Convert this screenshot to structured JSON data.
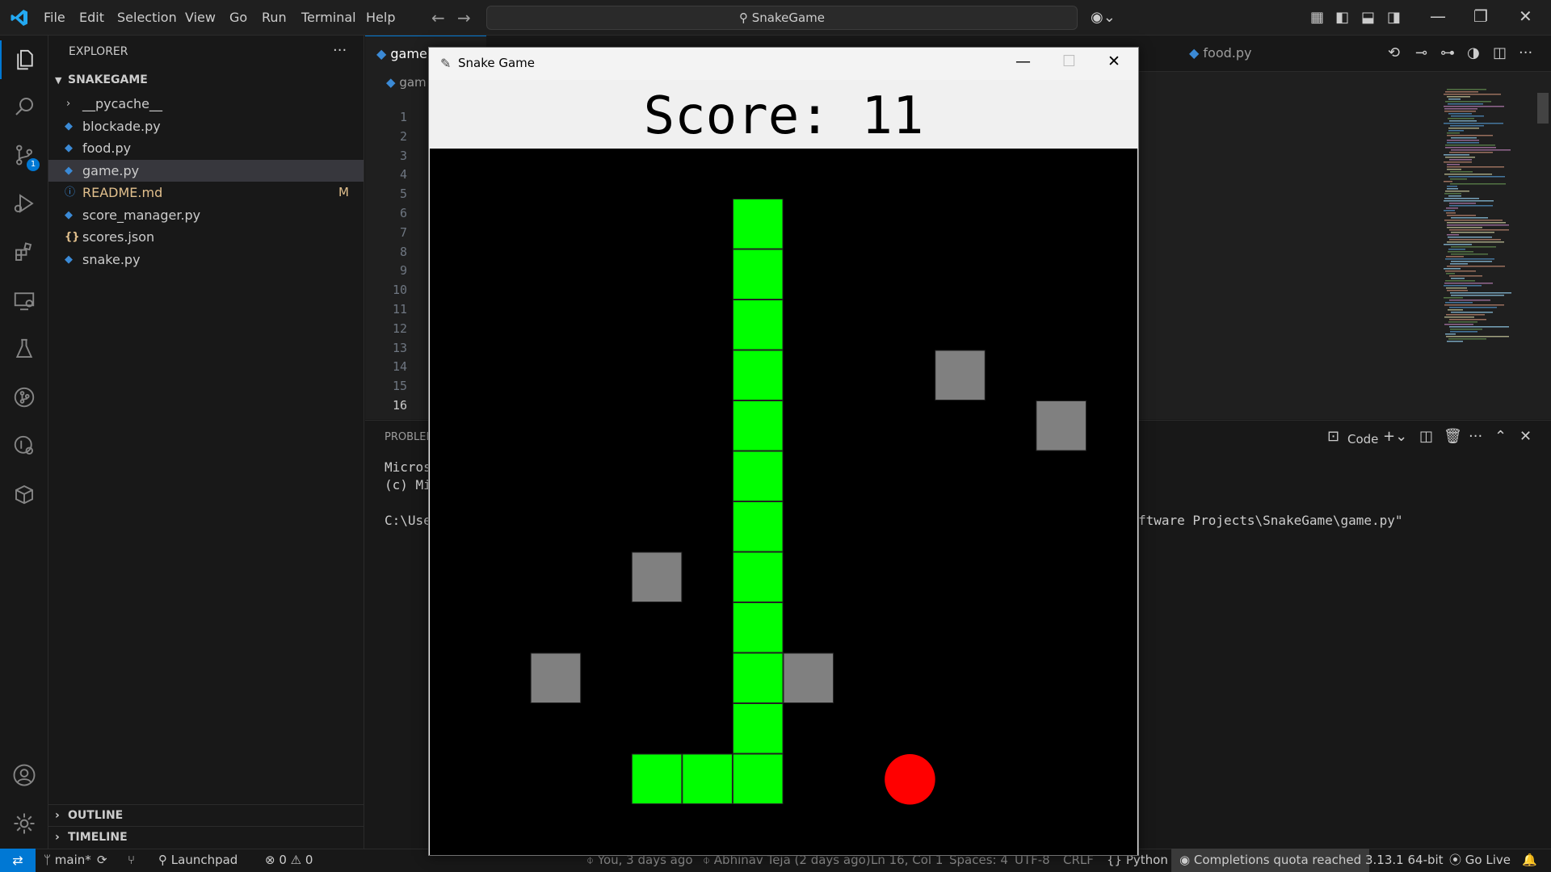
{
  "titlebar": {
    "menus": [
      "File",
      "Edit",
      "Selection",
      "View",
      "Go",
      "Run",
      "Terminal",
      "Help"
    ],
    "search_text": "SnakeGame"
  },
  "activity": {
    "scm_badge": "1"
  },
  "sidebar": {
    "title": "EXPLORER",
    "project": "SNAKEGAME",
    "items": [
      {
        "label": "__pycache__",
        "kind": "folder"
      },
      {
        "label": "blockade.py",
        "kind": "python"
      },
      {
        "label": "food.py",
        "kind": "python"
      },
      {
        "label": "game.py",
        "kind": "python",
        "selected": true
      },
      {
        "label": "README.md",
        "kind": "info",
        "badge": "M"
      },
      {
        "label": "score_manager.py",
        "kind": "python"
      },
      {
        "label": "scores.json",
        "kind": "json"
      },
      {
        "label": "snake.py",
        "kind": "python"
      }
    ],
    "outline": "OUTLINE",
    "timeline": "TIMELINE"
  },
  "editor": {
    "tabs": [
      "game",
      "food.py"
    ],
    "breadcrumb": "gam",
    "line_numbers": [
      "1",
      "2",
      "3",
      "4",
      "5",
      "6",
      "7",
      "8",
      "9",
      "10",
      "11",
      "12",
      "13",
      "14",
      "15",
      "16"
    ],
    "current_line": "16"
  },
  "panel": {
    "tab": "PROBLEM",
    "terminal_lines": [
      "Micros",
      "(c) Mi",
      "",
      "C:\\Use"
    ],
    "terminal_right": "ftware Projects\\SnakeGame\\game.py\"",
    "terminal_label": "Code"
  },
  "statusbar": {
    "branch": "main*",
    "launchpad": "Launchpad",
    "errors": "0",
    "warnings": "0",
    "blame_you": "You, 3 days ago",
    "blame_author": "Abhinav Teja (2 days ago)",
    "cursor": "Ln 16, Col 1",
    "spaces": "Spaces: 4",
    "encoding": "UTF-8",
    "eol": "CRLF",
    "language": "Python",
    "completions": "Completions quota reached",
    "interpreter": "3.13.1 64-bit",
    "golive": "Go Live"
  },
  "game": {
    "window_title": "Snake Game",
    "score_label": "Score:  11",
    "snake_color": "#00ff00",
    "block_color": "#808080",
    "food_color": "#ff0000",
    "grid": {
      "cols": 14,
      "rows": 14
    },
    "snake": [
      [
        6,
        1
      ],
      [
        6,
        2
      ],
      [
        6,
        3
      ],
      [
        6,
        4
      ],
      [
        6,
        5
      ],
      [
        6,
        6
      ],
      [
        6,
        7
      ],
      [
        6,
        8
      ],
      [
        6,
        9
      ],
      [
        6,
        10
      ],
      [
        6,
        11
      ],
      [
        6,
        12
      ],
      [
        5,
        12
      ],
      [
        4,
        12
      ]
    ],
    "blocks": [
      [
        10,
        4
      ],
      [
        12,
        5
      ],
      [
        4,
        8
      ],
      [
        2,
        10
      ],
      [
        7,
        10
      ]
    ],
    "food": [
      9,
      12
    ]
  }
}
